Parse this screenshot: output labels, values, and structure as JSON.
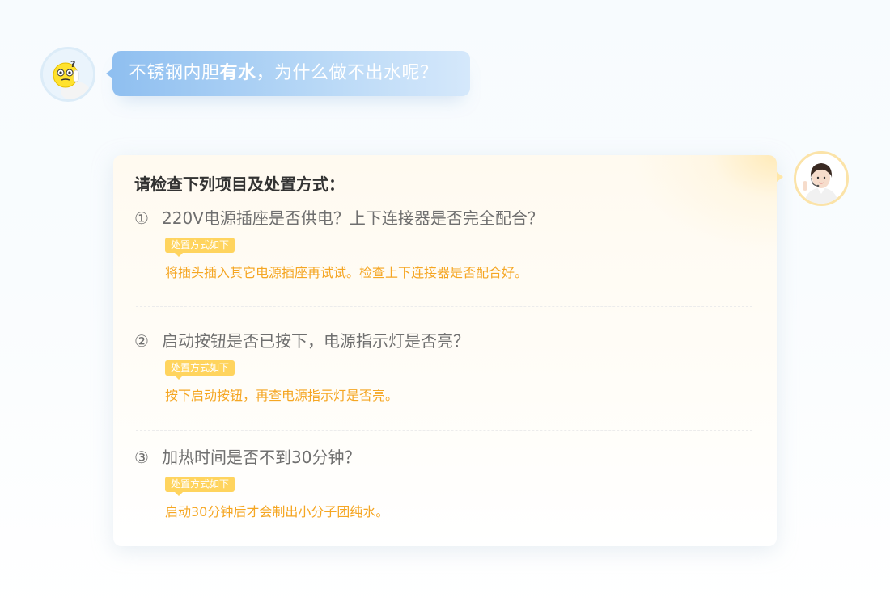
{
  "question": {
    "prefix": "不锈钢内胆",
    "highlight": "有水",
    "suffix": "，为什么做不出水呢？"
  },
  "answer": {
    "title": "请检查下列项目及处置方式：",
    "items": [
      {
        "number": "①",
        "question": "220V电源插座是否供电？上下连接器是否完全配合？",
        "tag": "处置方式如下",
        "solution": "将插头插入其它电源插座再试试。检查上下连接器是否配合好。"
      },
      {
        "number": "②",
        "question": "启动按钮是否已按下，电源指示灯是否亮？",
        "tag": "处置方式如下",
        "solution": "按下启动按钮，再查电源指示灯是否亮。"
      },
      {
        "number": "③",
        "question": "加热时间是否不到30分钟？",
        "tag": "处置方式如下",
        "solution": "启动30分钟后才会制出小分子团纯水。"
      }
    ]
  },
  "colors": {
    "bubble_blue": "#8fbff0",
    "tag_yellow": "#ffd45e",
    "solution_orange": "#f5a623",
    "question_gray": "#6f6f6f"
  },
  "icons": {
    "user_avatar": "confused-emoji-avatar",
    "staff_avatar": "customer-service-avatar"
  }
}
